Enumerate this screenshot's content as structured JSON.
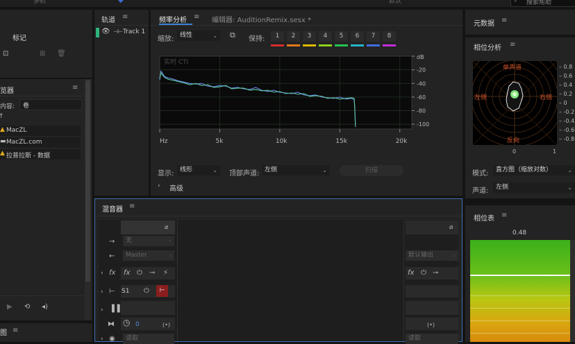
{
  "top_bar": {
    "partial_label": "多轨",
    "search_placeholder": "搜索帮助",
    "partial_right": "默认"
  },
  "markers_panel": {
    "title": "标记"
  },
  "media_browser": {
    "title": "媒体浏览器",
    "title_visible": "览器",
    "content_label": "内容:",
    "content_value": "卷",
    "items": [
      "MacZL",
      "MacZL.com",
      "拉普拉斯 - 数据"
    ]
  },
  "tracks_panel": {
    "title": "轨道",
    "tracks": [
      {
        "name": "Track 1"
      }
    ]
  },
  "frequency_panel": {
    "tab_freq": "频率分析",
    "tab_editor": "编辑器: AuditionRemix.sesx *",
    "scale_label": "缩放:",
    "scale_value": "线性",
    "hold_label": "保持:",
    "hold_buttons": [
      "1",
      "2",
      "3",
      "4",
      "5",
      "6",
      "7",
      "8"
    ],
    "hold_colors": [
      "#d32f2f",
      "#e37a18",
      "#e1b800",
      "#8fd11b",
      "#24c451",
      "#27b5c8",
      "#3f6ee0",
      "#c02ed8"
    ],
    "display_label": "显示:",
    "display_value": "线形",
    "channel_label": "顶部声道:",
    "channel_value": "左侧",
    "scan_button": "扫描",
    "advanced_label": "高级"
  },
  "chart_data": {
    "type": "line",
    "title": "实时 CTI",
    "x_axis": {
      "label": "Hz",
      "ticks": [
        "Hz",
        "5k",
        "10k",
        "15k",
        "20k"
      ],
      "range": [
        0,
        21000
      ]
    },
    "y_axis": {
      "unit": "dB",
      "ticks": [
        "dB",
        "-20",
        "-40",
        "-60",
        "-80",
        "-100"
      ],
      "range": [
        -107,
        0
      ]
    },
    "grid": true,
    "series": [
      {
        "color": "#6a88e8",
        "x": [
          0,
          100,
          200,
          400,
          700,
          1000,
          1500,
          2000,
          2500,
          3000,
          3500,
          4000,
          4500,
          5000,
          5500,
          6000,
          6500,
          7000,
          7500,
          8000,
          8500,
          9000,
          9500,
          10000,
          10500,
          11000,
          11500,
          12000,
          12500,
          13000,
          13500,
          14000,
          14500,
          15000,
          15500,
          16000,
          16200,
          16250,
          16300
        ],
        "y": [
          -35,
          -22,
          -24,
          -30,
          -32,
          -33,
          -36,
          -38,
          -40,
          -41,
          -40,
          -44,
          -45,
          -43,
          -44,
          -47,
          -46,
          -48,
          -49,
          -46,
          -50,
          -52,
          -50,
          -53,
          -54,
          -55,
          -53,
          -57,
          -58,
          -57,
          -60,
          -61,
          -62,
          -60,
          -63,
          -62,
          -64,
          -75,
          -100
        ]
      },
      {
        "color": "#5fc7a5",
        "x": [
          0,
          100,
          200,
          400,
          700,
          1000,
          1500,
          2000,
          2500,
          3000,
          3500,
          4000,
          4500,
          5000,
          5500,
          6000,
          6500,
          7000,
          7500,
          8000,
          8500,
          9000,
          9500,
          10000,
          10500,
          11000,
          11500,
          12000,
          12500,
          13000,
          13500,
          14000,
          14500,
          15000,
          15500,
          16000,
          16200,
          16250,
          16300
        ],
        "y": [
          -33,
          -24,
          -27,
          -31,
          -34,
          -35,
          -37,
          -39,
          -42,
          -40,
          -43,
          -42,
          -46,
          -45,
          -43,
          -48,
          -47,
          -47,
          -50,
          -49,
          -51,
          -50,
          -53,
          -52,
          -55,
          -54,
          -56,
          -55,
          -59,
          -58,
          -59,
          -62,
          -61,
          -63,
          -62,
          -61,
          -62,
          -78,
          -104
        ]
      }
    ]
  },
  "mixer_panel": {
    "title": "混音器",
    "input_value": "无",
    "output_value": "Master",
    "send_label": "S1",
    "volume_value": "0",
    "read_label": "读取",
    "default_output": "默认输出"
  },
  "metadata_panel": {
    "title": "元数据"
  },
  "phase_analysis": {
    "title": "相位分析",
    "label_top": "单声道",
    "label_left": "左侧",
    "label_right": "右侧",
    "label_bottom": "反向",
    "scale": [
      "0.8",
      "0.6",
      "0.4",
      "0.2",
      "0",
      "-0.2",
      "-0.4",
      "-0.6",
      "-0.8"
    ],
    "x_zero": "0",
    "x_one": "1",
    "mode_label": "模式:",
    "mode_value": "直方图（缩放对数）",
    "channel_label": "声道:",
    "channel_value": "左侧"
  },
  "phase_meter": {
    "title": "相位表",
    "value": "0.48"
  },
  "bottom_left": {
    "partial_title": "图"
  }
}
